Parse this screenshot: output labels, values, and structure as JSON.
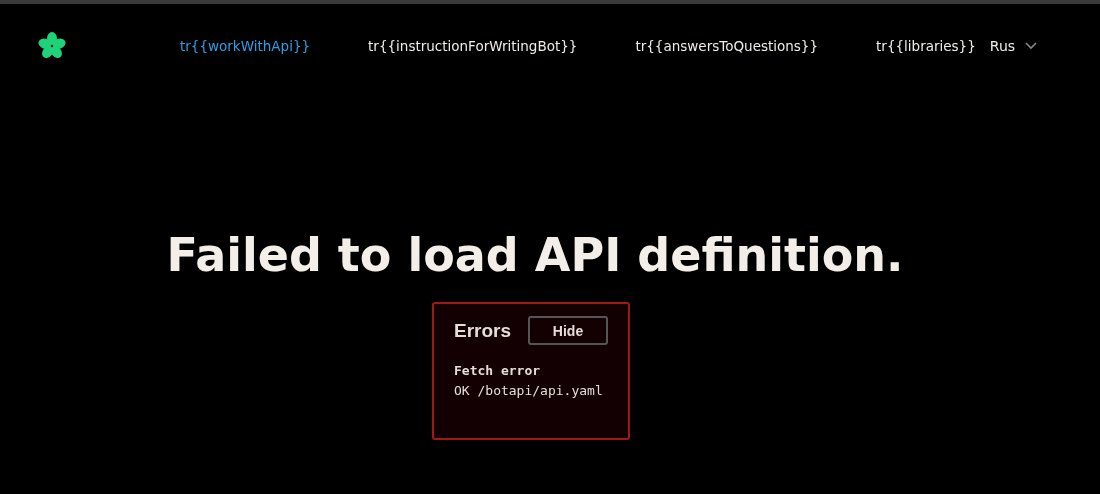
{
  "nav": {
    "items": [
      {
        "label": "tr{{workWithApi}}",
        "selected": true
      },
      {
        "label": "tr{{instructionForWritingBot}}",
        "selected": false
      },
      {
        "label": "tr{{answersToQuestions}}",
        "selected": false
      },
      {
        "label": "tr{{libraries}}",
        "selected": false
      }
    ],
    "language": "Rus"
  },
  "heading": "Failed to load API definition.",
  "errors": {
    "title": "Errors",
    "button": "Hide",
    "messages": [
      {
        "kind": "title",
        "text": "Fetch error"
      },
      {
        "kind": "detail",
        "text": "OK /botapi/api.yaml"
      }
    ]
  }
}
